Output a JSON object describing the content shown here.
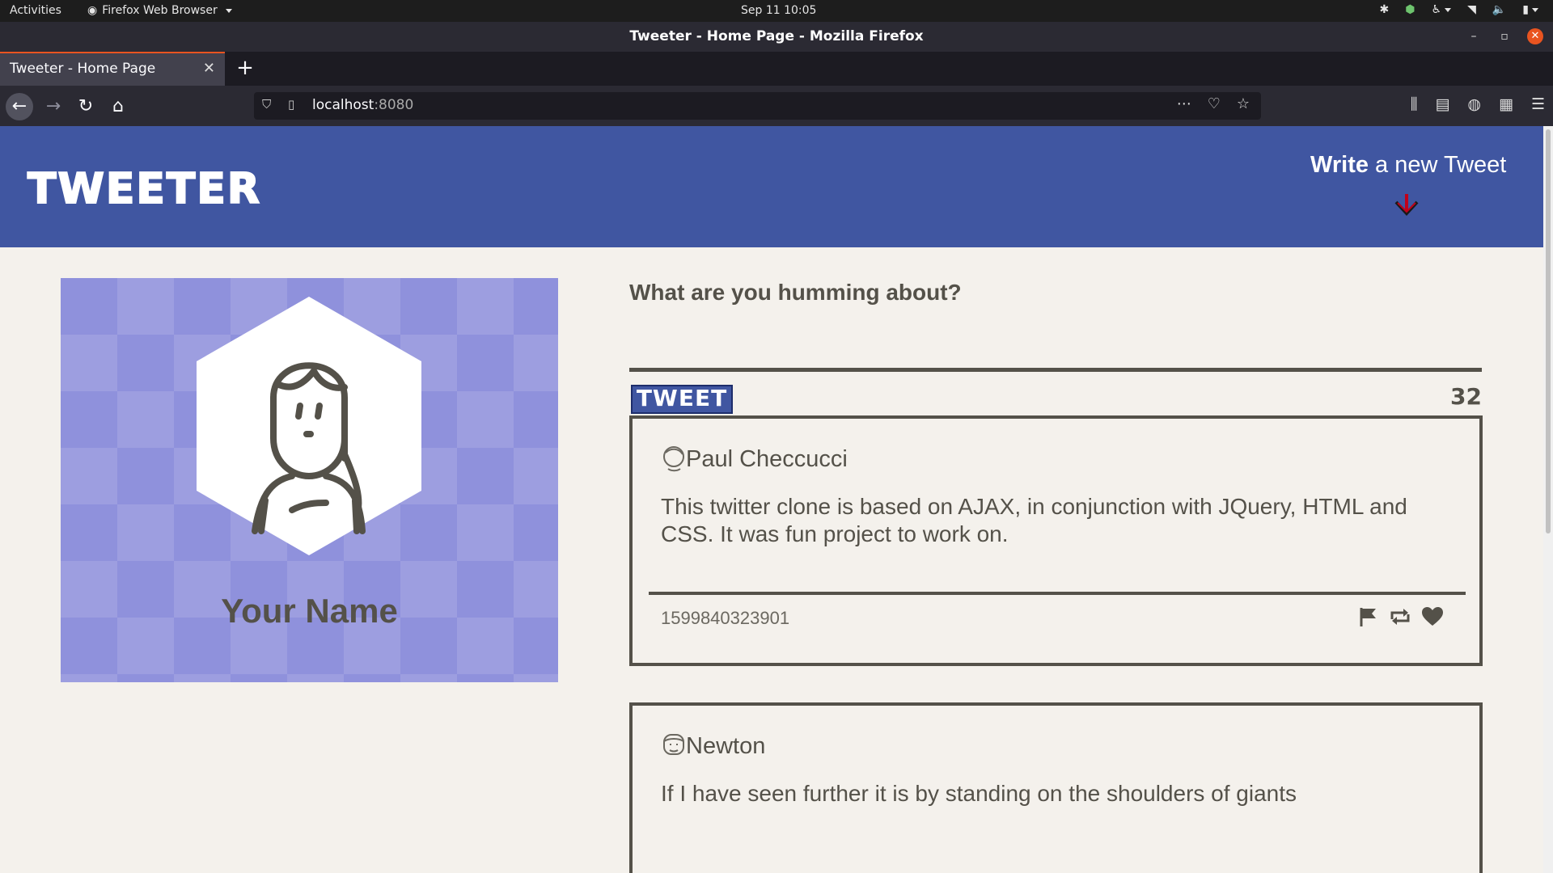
{
  "system": {
    "activities": "Activities",
    "app_menu": "Firefox Web Browser",
    "clock": "Sep 11  10:05"
  },
  "window": {
    "title": "Tweeter - Home Page - Mozilla Firefox"
  },
  "tabs": [
    {
      "label": "Tweeter - Home Page",
      "active": true
    }
  ],
  "address_bar": {
    "host": "localhost",
    "port": ":8080"
  },
  "site": {
    "brand": "TWEETER",
    "write_bold": "Write",
    "write_rest": " a new Tweet",
    "accent_color": "#4056a1"
  },
  "profile": {
    "name": "Your Name"
  },
  "compose": {
    "label": "What are you humming about?",
    "value": "",
    "button": "TWEET",
    "counter": "32"
  },
  "tweets": [
    {
      "author": "Paul Checcucci",
      "text": "This twitter clone is based on AJAX, in conjunction with JQuery, HTML and CSS. It was fun project to work on.",
      "timestamp": "1599840323901",
      "actions": [
        "flag-icon",
        "retweet-icon",
        "heart-icon"
      ]
    },
    {
      "author": "Newton",
      "text": "If I have seen further it is by standing on the shoulders of giants"
    }
  ]
}
